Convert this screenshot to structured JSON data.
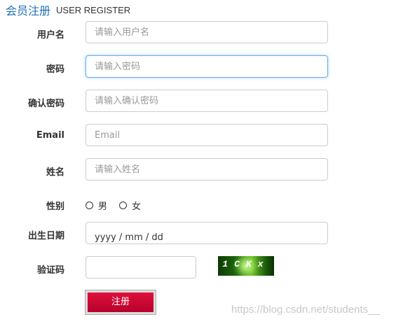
{
  "header": {
    "title_cn": "会员注册",
    "title_en": "USER REGISTER"
  },
  "form": {
    "username": {
      "label": "用户名",
      "placeholder": "请输入用户名"
    },
    "password": {
      "label": "密码",
      "placeholder": "请输入密码"
    },
    "confirm": {
      "label": "确认密码",
      "placeholder": "请输入确认密码"
    },
    "email": {
      "label": "Email",
      "placeholder": "Email"
    },
    "name": {
      "label": "姓名",
      "placeholder": "请输入姓名"
    },
    "gender": {
      "label": "性别",
      "options": [
        "男",
        "女"
      ]
    },
    "birthday": {
      "label": "出生日期",
      "value": "yyyy / mm / dd"
    },
    "captcha": {
      "label": "验证码",
      "image_text": "1CKx"
    },
    "submit_label": "注册"
  },
  "watermark": "https://blog.csdn.net/students__"
}
